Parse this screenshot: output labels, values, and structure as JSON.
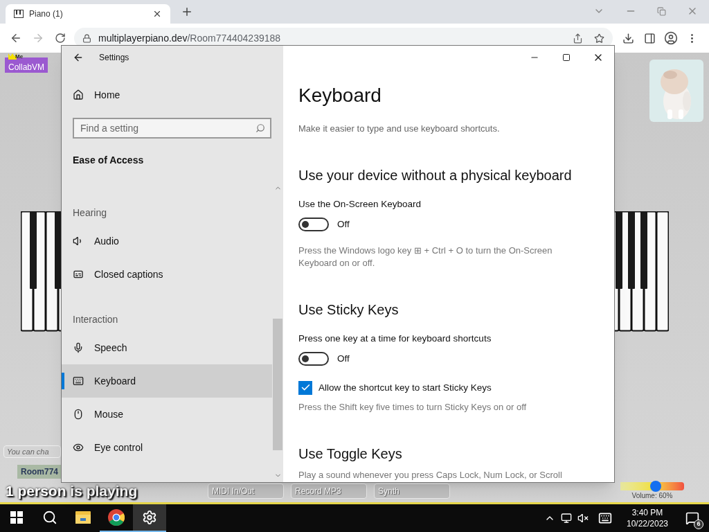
{
  "browser": {
    "tab": {
      "title": "Piano (1)"
    },
    "url": {
      "host": "multiplayerpiano.dev",
      "path": "/Room774404239188"
    }
  },
  "page": {
    "badge": {
      "crown_label": "Me",
      "name": "CollabVM"
    },
    "chat": {
      "placeholder": "You can cha"
    },
    "room_button": "Room774",
    "players": "1 person is playing",
    "buttons": [
      "MIDI In/Out",
      "Record MP3",
      "Synth"
    ],
    "volume": {
      "level": 0.55,
      "label": "Volume: 60%"
    }
  },
  "settings": {
    "title": "Settings",
    "home": "Home",
    "search": {
      "placeholder": "Find a setting"
    },
    "category": "Ease of Access",
    "nav": [
      {
        "kind": "header",
        "label": "Hearing"
      },
      {
        "kind": "item",
        "label": "Audio",
        "selected": false
      },
      {
        "kind": "item",
        "label": "Closed captions",
        "selected": false
      },
      {
        "kind": "header",
        "label": "Interaction"
      },
      {
        "kind": "item",
        "label": "Speech",
        "selected": false
      },
      {
        "kind": "item",
        "label": "Keyboard",
        "selected": true
      },
      {
        "kind": "item",
        "label": "Mouse",
        "selected": false
      },
      {
        "kind": "item",
        "label": "Eye control",
        "selected": false
      }
    ],
    "page_title": "Keyboard",
    "subtitle": "Make it easier to type and use keyboard shortcuts.",
    "sections": [
      {
        "heading": "Use your device without a physical keyboard",
        "items": [
          {
            "kind": "toggle",
            "label": "Use the On-Screen Keyboard",
            "on": false,
            "state_label": "Off"
          },
          {
            "kind": "note",
            "text": "Press the Windows logo key ⊞ + Ctrl + O to turn the On-Screen Keyboard on or off."
          }
        ]
      },
      {
        "heading": "Use Sticky Keys",
        "items": [
          {
            "kind": "toggle",
            "label": "Press one key at a time for keyboard shortcuts",
            "on": false,
            "state_label": "Off"
          },
          {
            "kind": "checkbox",
            "label": "Allow the shortcut key to start Sticky Keys",
            "checked": true
          },
          {
            "kind": "note",
            "text": "Press the Shift key five times to turn Sticky Keys on or off"
          }
        ]
      },
      {
        "heading": "Use Toggle Keys",
        "items": [
          {
            "kind": "note",
            "text": "Play a sound whenever you press Caps Lock, Num Lock, or Scroll"
          }
        ]
      }
    ]
  },
  "taskbar": {
    "apps": [
      {
        "selected": false,
        "running": false
      },
      {
        "selected": false,
        "running": false
      },
      {
        "selected": false,
        "running": false
      },
      {
        "selected": false,
        "running": true
      },
      {
        "selected": true,
        "running": true
      }
    ],
    "clock": {
      "time": "3:40 PM",
      "date": "10/22/2023"
    },
    "notifications": "6"
  }
}
